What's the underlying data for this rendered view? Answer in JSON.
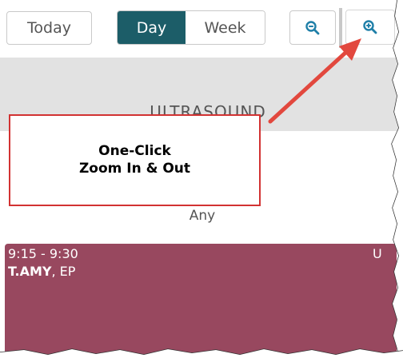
{
  "toolbar": {
    "today_label": "Today",
    "view_tabs": [
      {
        "label": "Day",
        "active": true
      },
      {
        "label": "Week",
        "active": false
      }
    ],
    "zoom_out_icon": "zoom-out-icon",
    "zoom_in_icon": "zoom-in-icon"
  },
  "header": {
    "resource_label": "ULTRASOUND"
  },
  "callout": {
    "line1": "One-Click",
    "line2": "Zoom In & Out"
  },
  "resource_filter": {
    "value": "Any"
  },
  "appointment": {
    "time_range": "9:15 - 9:30",
    "name": "T.AMY",
    "suffix": ", EP",
    "flag": "U"
  },
  "colors": {
    "active_tab": "#1c5d68",
    "appointment": "#98485f",
    "callout_border": "#d23232",
    "zoom_icon": "#1f7fa8",
    "header_band": "#e2e2e2"
  }
}
